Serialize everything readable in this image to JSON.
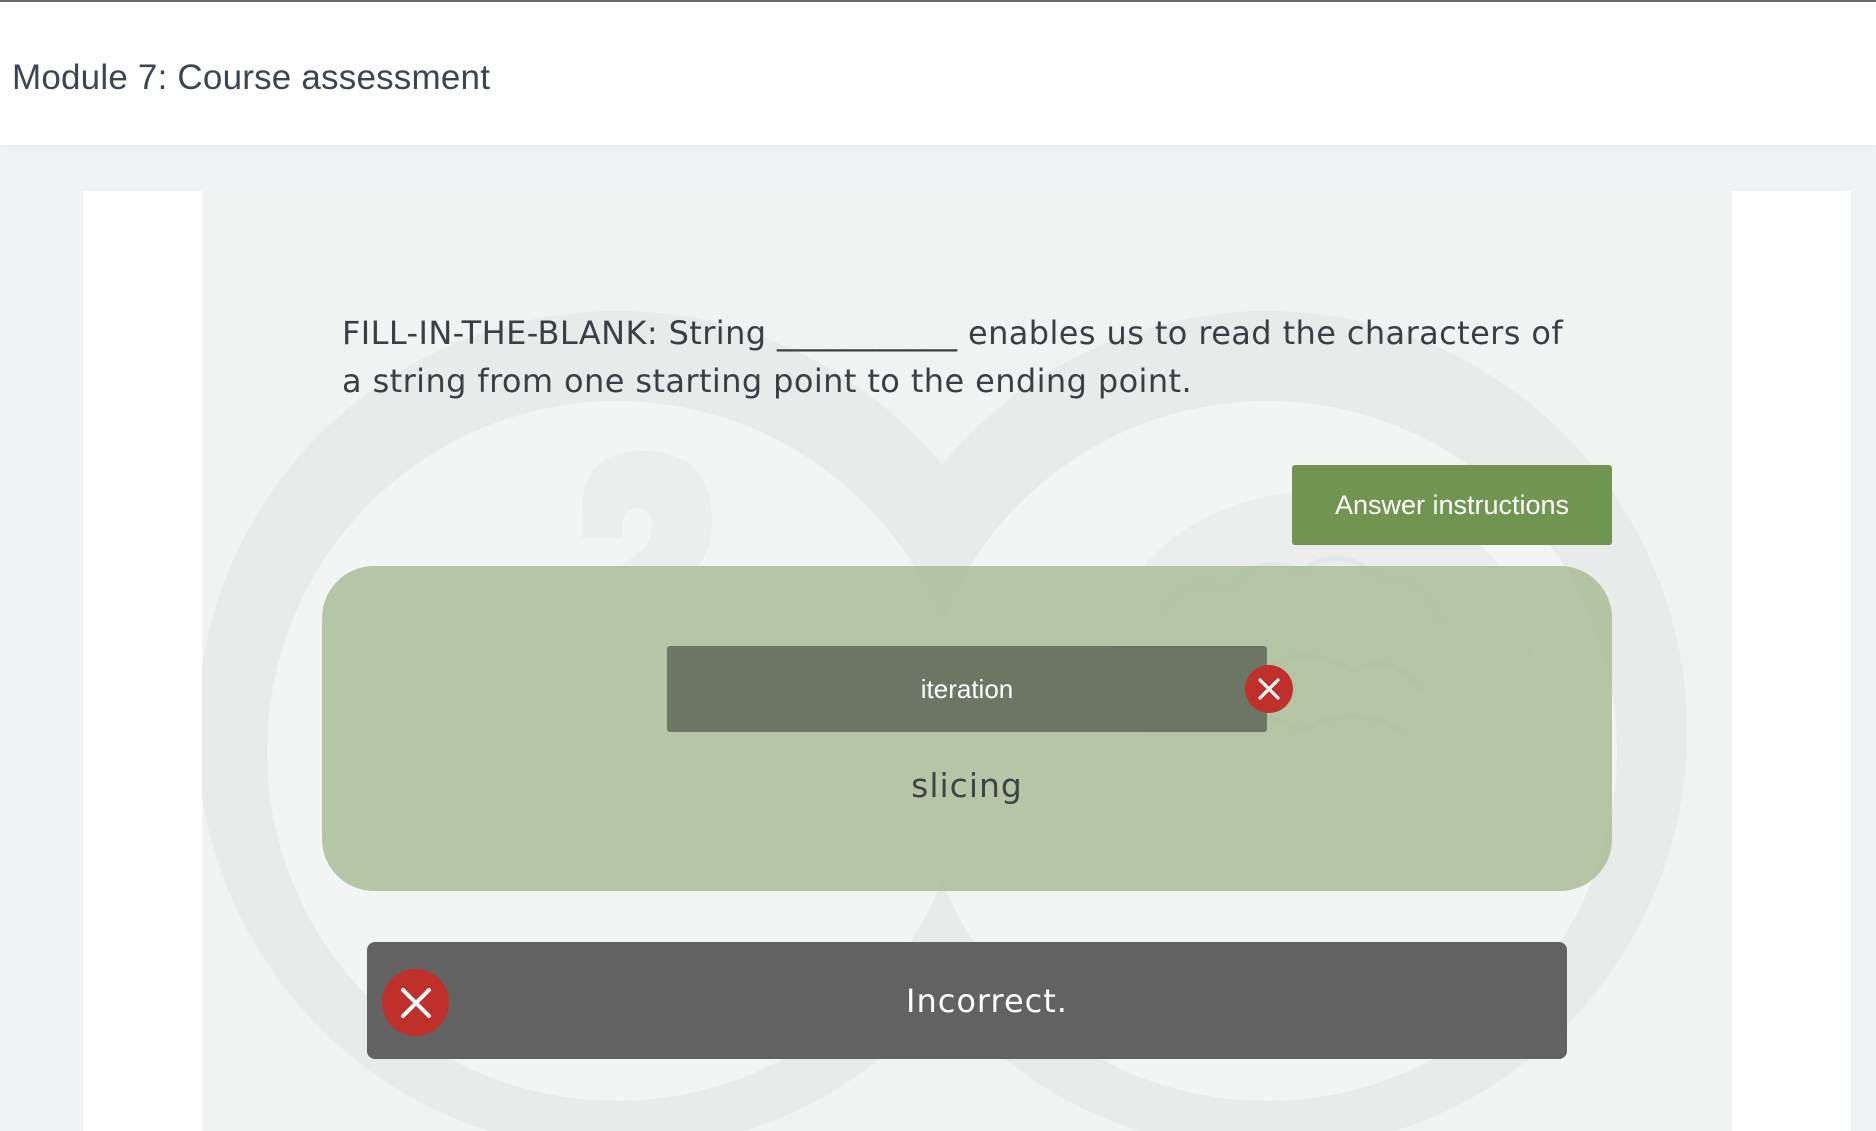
{
  "header": {
    "title": "Module 7: Course assessment"
  },
  "question": {
    "text": "FILL-IN-THE-BLANK: String ___________ enables us to read the characters of a string from one starting point to the ending point."
  },
  "instructions_button": {
    "label": "Answer instructions"
  },
  "answer": {
    "user_answer": "iteration",
    "remove_icon": "close-icon",
    "correct_answer": "slicing"
  },
  "feedback": {
    "status_icon": "x-circle-icon",
    "message": "Incorrect."
  },
  "colors": {
    "accent_green": "#6f9550",
    "drop_zone": "#a6bc94",
    "error_red": "#c0302a",
    "feedback_bg": "#626262"
  }
}
